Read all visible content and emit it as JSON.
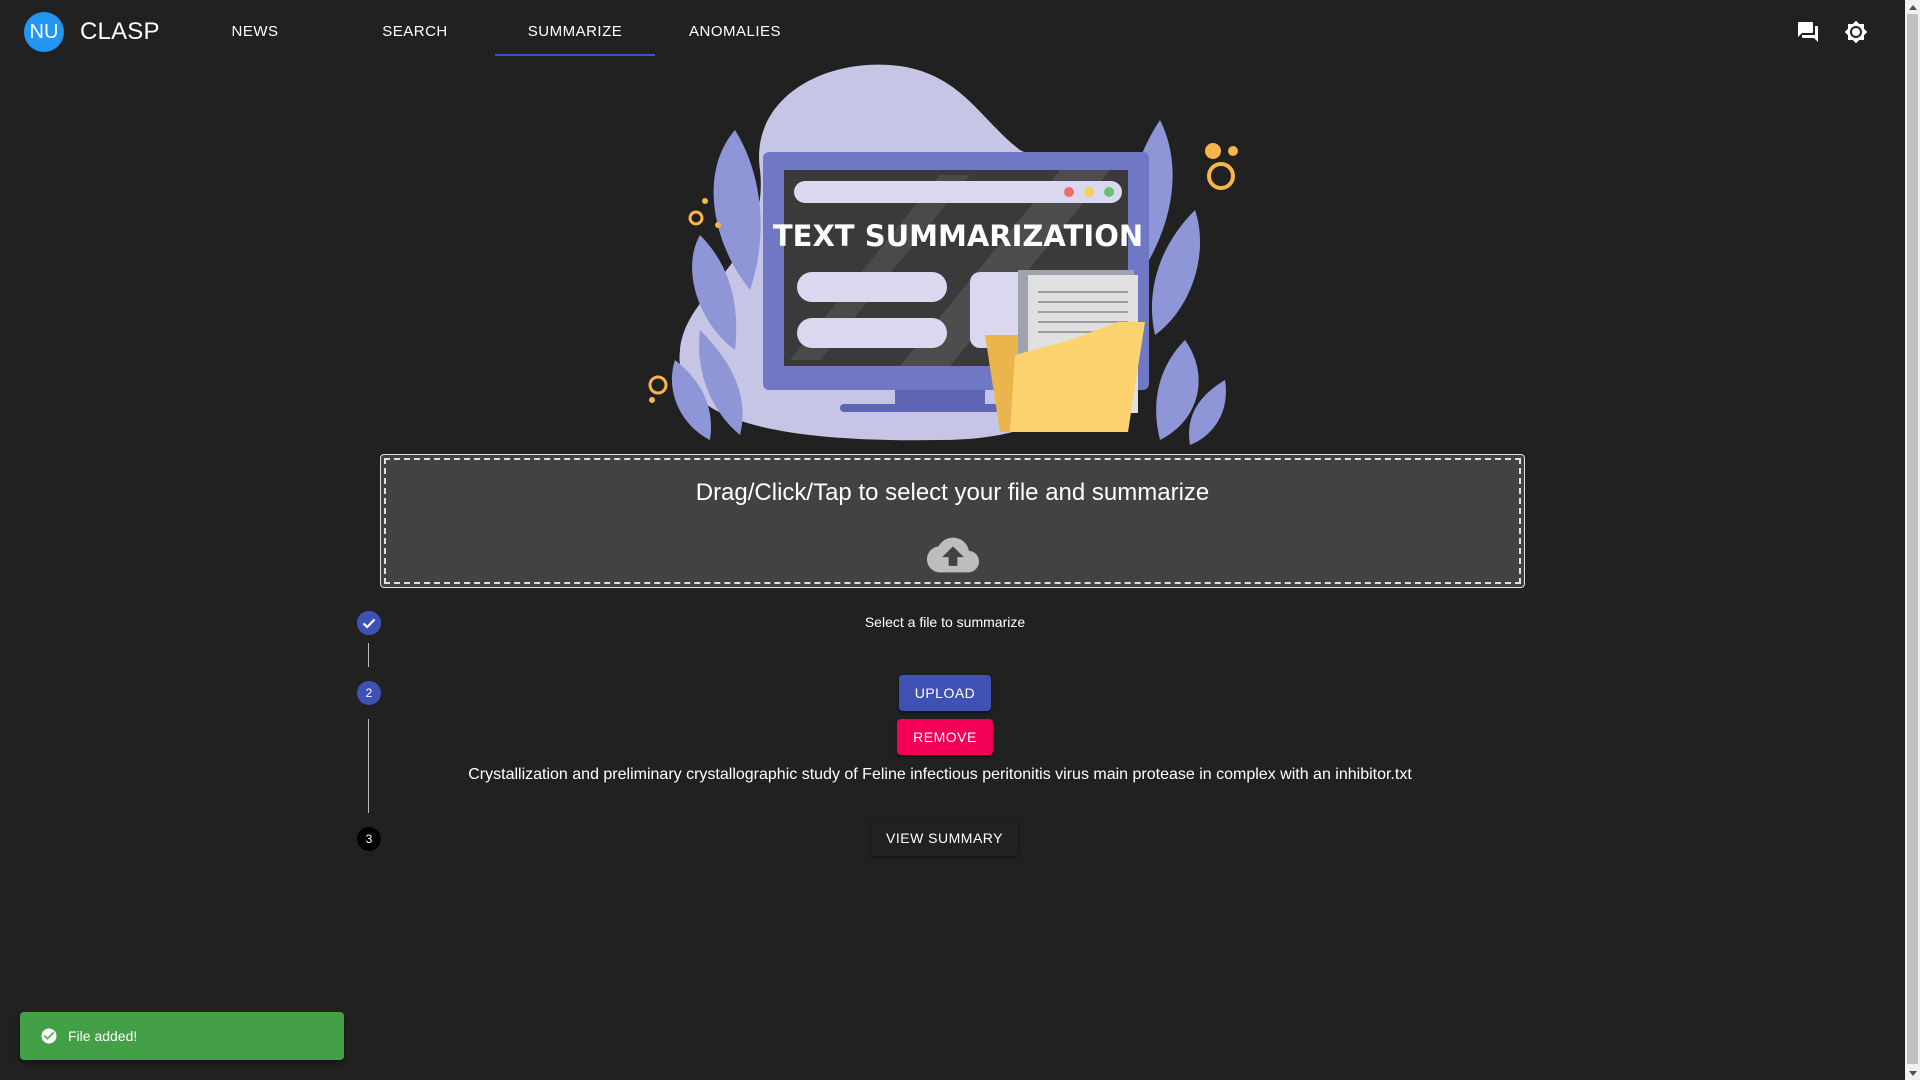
{
  "app": {
    "avatar_initials": "NU",
    "brand": "CLASP"
  },
  "nav": {
    "tabs": [
      {
        "label": "NEWS",
        "active": false
      },
      {
        "label": "SEARCH",
        "active": false
      },
      {
        "label": "SUMMARIZE",
        "active": true
      },
      {
        "label": "ANOMALIES",
        "active": false
      }
    ],
    "actions": [
      "chat-icon",
      "brightness-icon"
    ]
  },
  "hero": {
    "title": "TEXT SUMMARIZATION"
  },
  "dropzone": {
    "text": "Drag/Click/Tap to select your file and summarize",
    "icon": "cloud-upload-icon"
  },
  "stepper": {
    "steps": [
      {
        "number": "1",
        "label": "Select a file to summarize",
        "completed": true
      },
      {
        "number": "2",
        "active": true
      },
      {
        "number": "3",
        "active": false
      }
    ],
    "upload_label": "UPLOAD",
    "remove_label": "REMOVE",
    "file_name": "Crystallization and preliminary crystallographic study of Feline infectious peritonitis virus main protease in complex with an inhibitor.txt",
    "view_summary_label": "VIEW SUMMARY"
  },
  "snackbar": {
    "message": "File added!",
    "color": "#43a047"
  },
  "colors": {
    "primary": "#3f51b5",
    "secondary": "#f50057",
    "background": "#212121",
    "surface": "#424242"
  }
}
